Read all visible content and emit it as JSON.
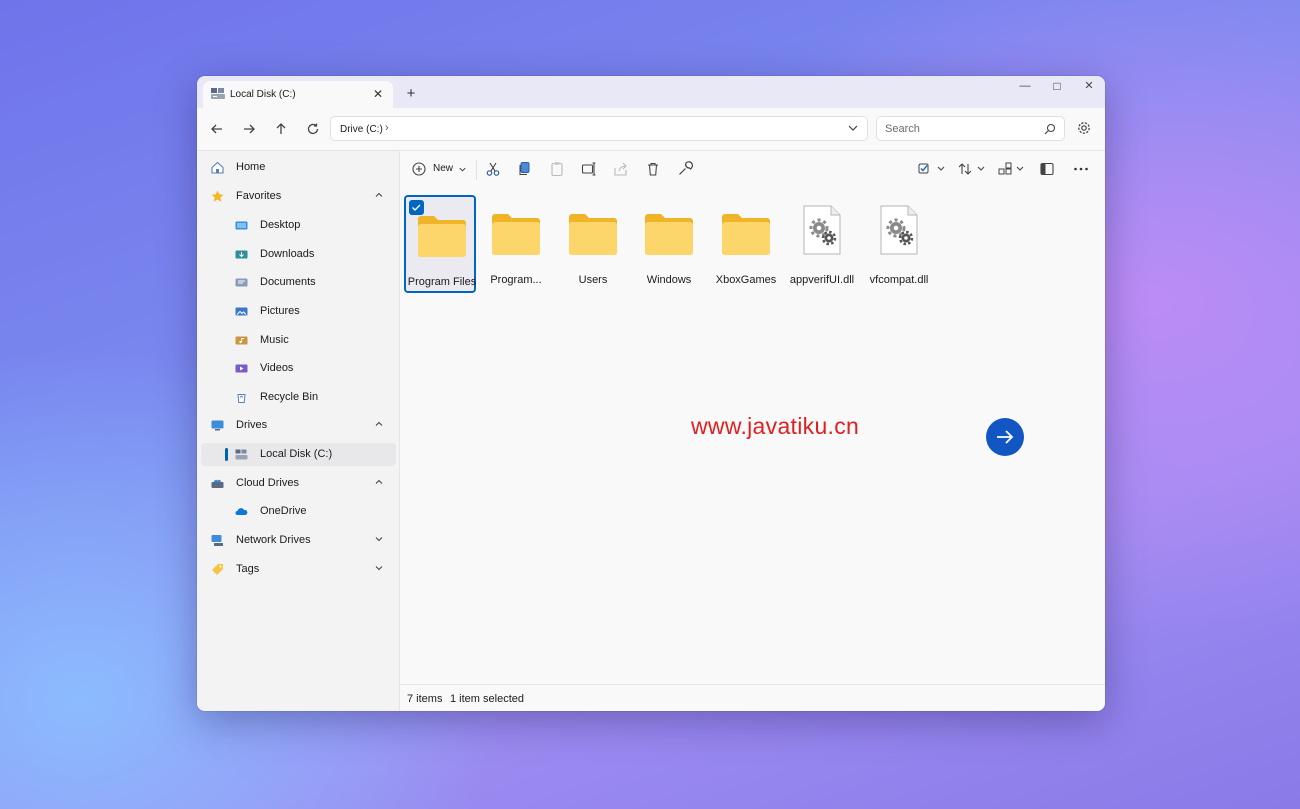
{
  "window": {
    "tab_title": "Local Disk (C:)",
    "new_tab": "+",
    "controls": {
      "minimize": "—",
      "maximize": "□",
      "close": "✕"
    }
  },
  "navigation": {
    "breadcrumb": "Drive (C:)",
    "breadcrumb_sep": "›",
    "search_placeholder": "Search"
  },
  "sidebar": {
    "home": "Home",
    "favorites": {
      "label": "Favorites",
      "items": [
        "Desktop",
        "Downloads",
        "Documents",
        "Pictures",
        "Music",
        "Videos",
        "Recycle Bin"
      ]
    },
    "drives": {
      "label": "Drives",
      "items": [
        "Local Disk (C:)"
      ]
    },
    "cloud_drives": {
      "label": "Cloud Drives",
      "items": [
        "OneDrive"
      ]
    },
    "network_drives": "Network Drives",
    "tags": "Tags"
  },
  "toolbar": {
    "new_label": "New"
  },
  "files": [
    {
      "name": "Program Files",
      "type": "folder",
      "selected": true
    },
    {
      "name": "Program...",
      "type": "folder"
    },
    {
      "name": "Users",
      "type": "folder"
    },
    {
      "name": "Windows",
      "type": "folder"
    },
    {
      "name": "XboxGames",
      "type": "folder"
    },
    {
      "name": "appverifUI.dll",
      "type": "dll"
    },
    {
      "name": "vfcompat.dll",
      "type": "dll"
    }
  ],
  "status": {
    "items": "7 items",
    "selected": "1 item selected"
  },
  "overlay": {
    "watermark": "www.javatiku.cn"
  },
  "colors": {
    "accent": "#0067c0",
    "folder": "#f8c83e",
    "watermark": "#e02020"
  }
}
